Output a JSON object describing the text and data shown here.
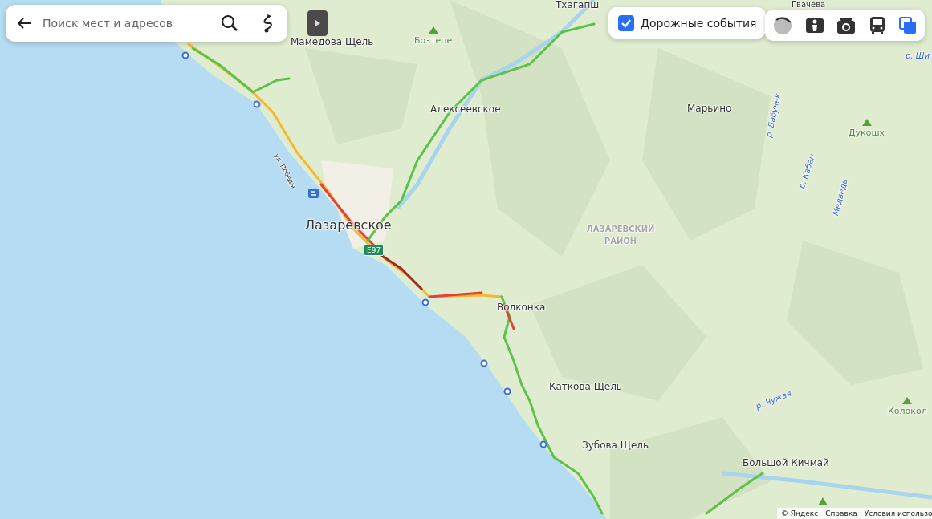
{
  "search": {
    "placeholder": "Поиск мест и адресов"
  },
  "traffic_toggle": {
    "label": "Дорожные события",
    "checked": true
  },
  "map_labels": [
    {
      "kind": "settlement",
      "text": "Тхагапш"
    },
    {
      "kind": "settlement",
      "text": "Гвачева"
    },
    {
      "kind": "settlement",
      "text": "Мамедова Щель"
    },
    {
      "kind": "peak",
      "text": "Бозтепе"
    },
    {
      "kind": "settlement",
      "text": "Алексеевское"
    },
    {
      "kind": "settlement",
      "text": "Марьино"
    },
    {
      "kind": "river",
      "text": "р. Ши"
    },
    {
      "kind": "peak",
      "text": "Дукошх"
    },
    {
      "kind": "river",
      "text": "р. Бабучек"
    },
    {
      "kind": "river",
      "text": "р. Кабан"
    },
    {
      "kind": "river",
      "text": "Медведь"
    },
    {
      "kind": "street",
      "text": "ул. Победы"
    },
    {
      "kind": "city",
      "text": "Лазаревское"
    },
    {
      "kind": "road_badge",
      "text": "E97"
    },
    {
      "kind": "district",
      "text": "ЛАЗАРЕВСКИЙ РАЙОН"
    },
    {
      "kind": "settlement",
      "text": "Волконка"
    },
    {
      "kind": "settlement",
      "text": "Каткова Щель"
    },
    {
      "kind": "river",
      "text": "р. Чужая"
    },
    {
      "kind": "peak",
      "text": "Колокол"
    },
    {
      "kind": "settlement",
      "text": "Зубова Щель"
    },
    {
      "kind": "settlement",
      "text": "Большой Кичмай"
    }
  ],
  "footer": {
    "copyright": "© Яндекс",
    "links": [
      "Справка",
      "Условия использо"
    ]
  }
}
